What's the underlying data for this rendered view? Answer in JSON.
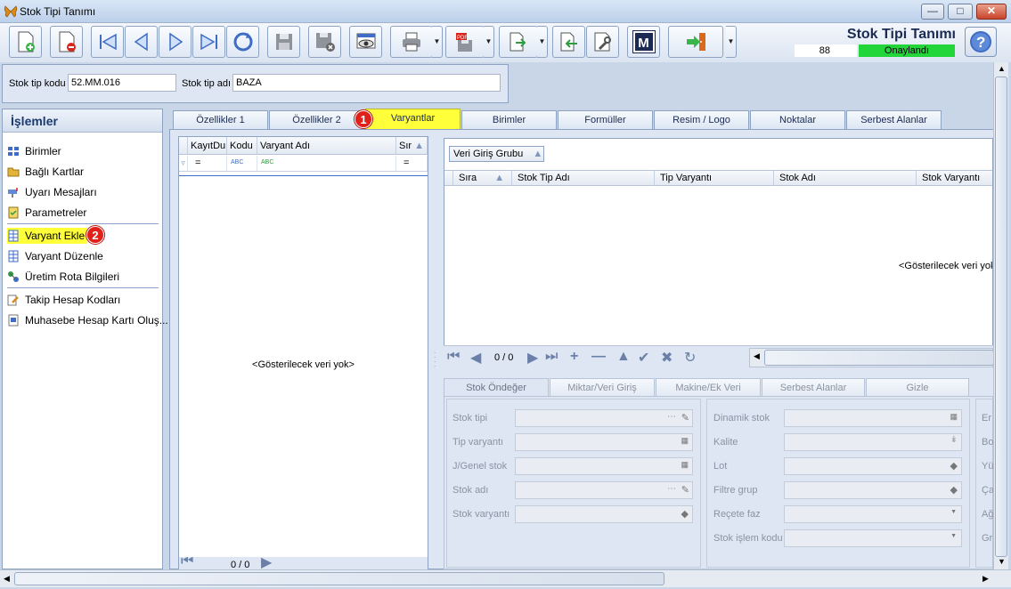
{
  "window": {
    "title": "Stok Tipi Tanımı"
  },
  "header": {
    "title": "Stok Tipi Tanımı",
    "number": "88",
    "status": "Onaylandı",
    "status_color": "#22d63a"
  },
  "toolbar": {
    "icons": [
      "new-doc-icon",
      "delete-doc-icon",
      "first-icon",
      "prev-icon",
      "next-icon",
      "last-icon",
      "refresh-icon",
      "save-icon",
      "save-close-icon",
      "preview-icon",
      "print-icon",
      "pdf-icon",
      "export-icon",
      "import-icon",
      "tools-icon",
      "m-icon",
      "exit-icon"
    ],
    "m_label": "M"
  },
  "form": {
    "code_label": "Stok tip kodu",
    "code_value": "52.MM.016",
    "name_label": "Stok tip adı",
    "name_value": "BAZA"
  },
  "sidebar": {
    "title": "İşlemler",
    "items": [
      {
        "label": "Birimler",
        "icon": "units-icon"
      },
      {
        "label": "Bağlı Kartlar",
        "icon": "folder-icon"
      },
      {
        "label": "Uyarı Mesajları",
        "icon": "mailbox-icon"
      },
      {
        "label": "Parametreler",
        "icon": "checklist-icon"
      },
      {
        "label": "Varyant Ekle",
        "icon": "grid-icon",
        "highlight": "#ffff3a"
      },
      {
        "label": "Varyant Düzenle",
        "icon": "grid-icon"
      },
      {
        "label": "Üretim Rota Bilgileri",
        "icon": "route-icon"
      },
      {
        "label": "Takip Hesap Kodları",
        "icon": "pencil-icon"
      },
      {
        "label": "Muhasebe Hesap Kartı Oluş...",
        "icon": "card-icon"
      }
    ]
  },
  "badges": {
    "one": "1",
    "two": "2"
  },
  "tabs": [
    {
      "label": "Özellikler 1"
    },
    {
      "label": "Özellikler 2"
    },
    {
      "label": "Varyantlar",
      "active": true
    },
    {
      "label": "Birimler"
    },
    {
      "label": "Formüller"
    },
    {
      "label": "Resim / Logo"
    },
    {
      "label": "Noktalar"
    },
    {
      "label": "Serbest Alanlar"
    }
  ],
  "left_grid": {
    "columns": [
      "KayıtDu",
      "Kodu",
      "Varyant Adı",
      "Sır"
    ],
    "filter": [
      "=",
      "ABC",
      "ABC",
      "="
    ],
    "empty": "<Gösterilecek veri yok>",
    "pager": "0 / 0"
  },
  "right_grid": {
    "group_button": "Veri Giriş Grubu",
    "columns": [
      "Sıra",
      "Stok Tip Adı",
      "Tip Varyantı",
      "Stok Adı",
      "Stok Varyantı"
    ],
    "empty": "<Gösterilecek veri yok>",
    "pager": "0 / 0"
  },
  "bottom_tabs": [
    {
      "label": "Stok Öndeğer",
      "active": true
    },
    {
      "label": "Miktar/Veri Giriş"
    },
    {
      "label": "Makine/Ek Veri"
    },
    {
      "label": "Serbest Alanlar"
    },
    {
      "label": "Gizle"
    }
  ],
  "fields_left": [
    "Stok tipi",
    "Tip varyantı",
    "J/Genel stok",
    "Stok adı",
    "Stok varyantı"
  ],
  "fields_mid": [
    "Dinamik stok",
    "Kalite",
    "Lot",
    "Filtre grup",
    "Reçete faz",
    "Stok işlem kodu"
  ],
  "fields_right": [
    "Er",
    "Bo",
    "Yü",
    "Ça",
    "Ağ",
    "Gr"
  ]
}
